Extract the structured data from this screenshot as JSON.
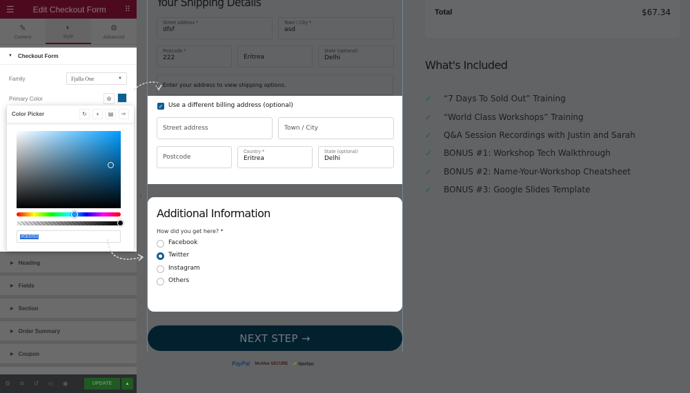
{
  "editor": {
    "title": "Edit Checkout Form",
    "tabs": [
      {
        "label": "Content",
        "icon": "pencil-icon"
      },
      {
        "label": "Style",
        "icon": "contrast-icon",
        "active": true
      },
      {
        "label": "Advanced",
        "icon": "gear-icon"
      }
    ],
    "section_open": "Checkout Form",
    "family_label": "Family",
    "family_value": "Fjalla One",
    "primary_color_label": "Primary Color",
    "primary_color": "#0b5f93",
    "color_picker": {
      "title": "Color Picker",
      "hex_value": "#0b5f93",
      "tools": [
        "reset-icon",
        "add-icon",
        "delete-icon",
        "eyedropper-icon"
      ]
    },
    "collapsed_sections": [
      "Heading",
      "Fields",
      "Section",
      "Order Summary",
      "Coupon"
    ],
    "footer": {
      "update_label": "UPDATE",
      "icons": [
        "settings-icon",
        "layers-icon",
        "history-icon",
        "responsive-icon",
        "preview-icon"
      ]
    }
  },
  "shipping": {
    "title": "Your Shipping Details",
    "street": {
      "label": "Street address *",
      "value": "dfsf"
    },
    "town": {
      "label": "Town / City *",
      "value": "asd"
    },
    "postcode": {
      "label": "Postcode *",
      "value": "222"
    },
    "country": {
      "value": "Eritrea"
    },
    "state": {
      "label": "State (optional)",
      "value": "Delhi"
    },
    "note": "Enter your address to view shipping options."
  },
  "billing": {
    "checkbox_label": "Use a different billing address (optional)",
    "checked": true,
    "street_placeholder": "Street address",
    "town_placeholder": "Town / City",
    "postcode_placeholder": "Postcode",
    "country": {
      "label": "Country *",
      "value": "Eritrea"
    },
    "state": {
      "label": "State (optional)",
      "value": "Delhi"
    }
  },
  "additional": {
    "title": "Additional Information",
    "question": "How did you get here? *",
    "options": [
      "Facebook",
      "Twitter",
      "Instagram",
      "Others"
    ],
    "selected": "Twitter"
  },
  "next_button": "NEXT STEP →",
  "badges": [
    "PayPal",
    "McAfee SECURE",
    "Norton"
  ],
  "summary": {
    "total_label": "Total",
    "total_value": "$67.34"
  },
  "included": {
    "title": "What's Included",
    "items": [
      "“7 Days To Sold Out” Training",
      "“World Class Workshops” Training",
      "Q&A Session Recordings with Justin and Sarah",
      "BONUS #1: Workshop Tech Walkthrough",
      "BONUS #2: Name-Your-Workshop Cheatsheet",
      "BONUS #3: Google Slides Template"
    ]
  }
}
